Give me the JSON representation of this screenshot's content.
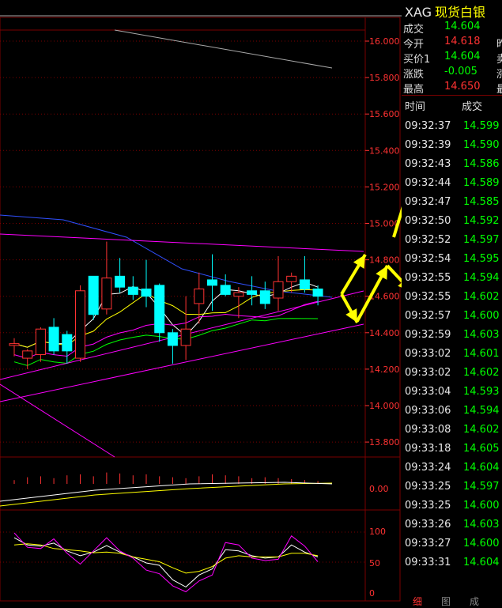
{
  "colors": {
    "up": "#ff3232",
    "down": "#00ffff",
    "flat": "#00ff00",
    "grid": "#7a0000",
    "ma1": "#ffffff",
    "ma2": "#ffff00",
    "ma3": "#ff00ff",
    "ma4": "#00ff00",
    "ma5": "#3050ff",
    "arrow": "#ffff00"
  },
  "header": {
    "code": "XAG",
    "name": "现货白银"
  },
  "quote": [
    {
      "label": "成交",
      "value": "14.604",
      "color": "#00ff00",
      "extra": ""
    },
    {
      "label": "今开",
      "value": "14.618",
      "color": "#ff3232",
      "extra": "昨"
    },
    {
      "label": "买价1",
      "value": "14.604",
      "color": "#00ff00",
      "extra": "卖"
    },
    {
      "label": "涨跌",
      "value": "-0.005",
      "color": "#00ff00",
      "extra": "涨"
    },
    {
      "label": "最高",
      "value": "14.650",
      "color": "#ff3232",
      "extra": "最"
    }
  ],
  "ticks_header": {
    "time": "时间",
    "price": "成交"
  },
  "ticks": [
    {
      "t": "09:32:37",
      "p": "14.599"
    },
    {
      "t": "09:32:39",
      "p": "14.590"
    },
    {
      "t": "09:32:43",
      "p": "14.586"
    },
    {
      "t": "09:32:44",
      "p": "14.589"
    },
    {
      "t": "09:32:47",
      "p": "14.585"
    },
    {
      "t": "09:32:50",
      "p": "14.592"
    },
    {
      "t": "09:32:52",
      "p": "14.597"
    },
    {
      "t": "09:32:54",
      "p": "14.595"
    },
    {
      "t": "09:32:55",
      "p": "14.594"
    },
    {
      "t": "09:32:55",
      "p": "14.602"
    },
    {
      "t": "09:32:57",
      "p": "14.600"
    },
    {
      "t": "09:32:59",
      "p": "14.603"
    },
    {
      "t": "09:33:02",
      "p": "14.601"
    },
    {
      "t": "09:33:02",
      "p": "14.602"
    },
    {
      "t": "09:33:04",
      "p": "14.593"
    },
    {
      "t": "09:33:06",
      "p": "14.594"
    },
    {
      "t": "09:33:08",
      "p": "14.602"
    },
    {
      "t": "09:33:18",
      "p": "14.605"
    },
    {
      "t": "09:33:24",
      "p": "14.604"
    },
    {
      "t": "09:33:25",
      "p": "14.597"
    },
    {
      "t": "09:33:25",
      "p": "14.600"
    },
    {
      "t": "09:33:26",
      "p": "14.603"
    },
    {
      "t": "09:33:27",
      "p": "14.600"
    },
    {
      "t": "09:33:31",
      "p": "14.604"
    }
  ],
  "footer_tabs": [
    "细",
    "图",
    "成"
  ],
  "chart_data": {
    "type": "candlestick",
    "price_axis": {
      "ticks": [
        "16.000",
        "15.800",
        "15.600",
        "15.400",
        "15.200",
        "15.000",
        "14.800",
        "14.600",
        "14.400",
        "14.200",
        "14.000",
        "13.800"
      ],
      "min": 13.8,
      "max": 16.0
    },
    "macd_axis": {
      "ticks": [
        "0.00"
      ]
    },
    "kdj_axis": {
      "ticks": [
        "100",
        "50",
        "0"
      ]
    },
    "candles": [
      {
        "o": 14.33,
        "h": 14.37,
        "l": 14.27,
        "c": 14.34
      },
      {
        "o": 14.26,
        "h": 14.31,
        "l": 14.2,
        "c": 14.3
      },
      {
        "o": 14.28,
        "h": 14.43,
        "l": 14.24,
        "c": 14.42
      },
      {
        "o": 14.43,
        "h": 14.48,
        "l": 14.28,
        "c": 14.3
      },
      {
        "o": 14.39,
        "h": 14.41,
        "l": 14.23,
        "c": 14.3
      },
      {
        "o": 14.26,
        "h": 14.66,
        "l": 14.24,
        "c": 14.63
      },
      {
        "o": 14.71,
        "h": 14.71,
        "l": 14.47,
        "c": 14.5
      },
      {
        "o": 14.53,
        "h": 14.9,
        "l": 14.5,
        "c": 14.7
      },
      {
        "o": 14.71,
        "h": 14.81,
        "l": 14.62,
        "c": 14.65
      },
      {
        "o": 14.65,
        "h": 14.71,
        "l": 14.58,
        "c": 14.61
      },
      {
        "o": 14.64,
        "h": 14.8,
        "l": 14.54,
        "c": 14.6
      },
      {
        "o": 14.66,
        "h": 14.67,
        "l": 14.35,
        "c": 14.4
      },
      {
        "o": 14.4,
        "h": 14.42,
        "l": 14.23,
        "c": 14.33
      },
      {
        "o": 14.33,
        "h": 14.6,
        "l": 14.25,
        "c": 14.42
      },
      {
        "o": 14.56,
        "h": 14.73,
        "l": 14.45,
        "c": 14.64
      },
      {
        "o": 14.69,
        "h": 14.83,
        "l": 14.52,
        "c": 14.66
      },
      {
        "o": 14.66,
        "h": 14.72,
        "l": 14.6,
        "c": 14.61
      },
      {
        "o": 14.6,
        "h": 14.65,
        "l": 14.48,
        "c": 14.62
      },
      {
        "o": 14.63,
        "h": 14.71,
        "l": 14.55,
        "c": 14.61
      },
      {
        "o": 14.63,
        "h": 14.68,
        "l": 14.53,
        "c": 14.56
      },
      {
        "o": 14.59,
        "h": 14.82,
        "l": 14.52,
        "c": 14.68
      },
      {
        "o": 14.68,
        "h": 14.73,
        "l": 14.62,
        "c": 14.71
      },
      {
        "o": 14.69,
        "h": 14.82,
        "l": 14.62,
        "c": 14.64
      },
      {
        "o": 14.64,
        "h": 14.66,
        "l": 14.55,
        "c": 14.6
      }
    ],
    "macd_hist": [
      0.2,
      0.35,
      0.4,
      0.3,
      0.45,
      0.5,
      0.4,
      0.6,
      0.55,
      0.45,
      0.5,
      0.4,
      0.35,
      0.3,
      0.4,
      0.5,
      0.45,
      0.4,
      0.3,
      0.35,
      0.3,
      0.25,
      0.2,
      0.15
    ],
    "kdj": {
      "k": [
        92,
        80,
        78,
        83,
        70,
        62,
        68,
        79,
        68,
        60,
        50,
        46,
        22,
        10,
        30,
        40,
        72,
        70,
        62,
        58,
        60,
        80,
        68,
        60
      ],
      "d": [
        80,
        82,
        80,
        74,
        72,
        70,
        67,
        68,
        66,
        60,
        56,
        52,
        42,
        33,
        36,
        44,
        58,
        62,
        60,
        60,
        60,
        66,
        66,
        62
      ],
      "j": [
        100,
        76,
        74,
        90,
        66,
        48,
        70,
        92,
        70,
        58,
        38,
        32,
        12,
        2,
        20,
        30,
        84,
        80,
        58,
        54,
        56,
        95,
        78,
        52
      ]
    }
  }
}
